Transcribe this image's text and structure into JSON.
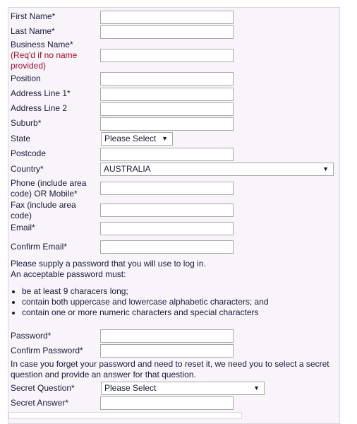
{
  "form": {
    "first_name": "First Name*",
    "last_name": "Last Name*",
    "business_name": "Business Name*",
    "business_note": "(Req'd if no name provided)",
    "position": "Position",
    "address1": "Address Line 1*",
    "address2": "Address Line 2",
    "suburb": "Suburb*",
    "state": "State",
    "state_value": "Please Select",
    "postcode": "Postcode",
    "country": "Country*",
    "country_value": "AUSTRALIA",
    "phone": "Phone (include area code) OR Mobile*",
    "fax": "Fax (include area code)",
    "email": "Email*",
    "confirm_email": "Confirm Email*",
    "password_intro": "Please supply a password that you will use to log in.",
    "password_intro2": "An acceptable password must:",
    "rules": [
      "be at least 9 characers long;",
      "contain both uppercase and lowercase alphabetic characters; and",
      "contain one or more numeric characters and special characters"
    ],
    "password": "Password*",
    "confirm_password": "Confirm Password*",
    "secret_intro": "In case you forget your password and need to reset it, we need you to select a secret question and provide an answer for that question.",
    "secret_question": "Secret Question*",
    "secret_question_value": "Please Select",
    "secret_answer": "Secret Answer*"
  },
  "icons": {
    "dropdown": "triangle-down-icon"
  },
  "colors": {
    "panel_bg": "#f8f4fa",
    "note_red": "#a0102a"
  }
}
